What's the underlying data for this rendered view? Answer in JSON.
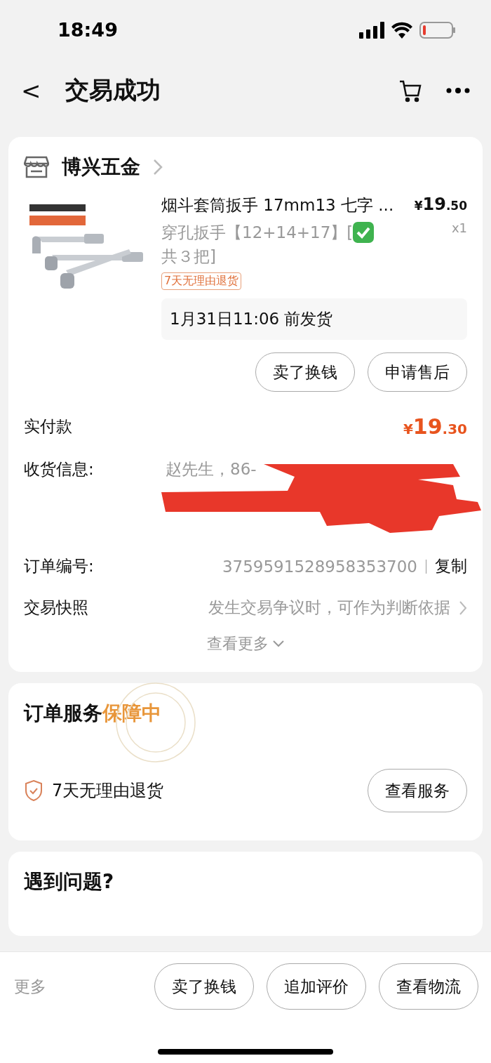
{
  "status_bar": {
    "time": "18:49"
  },
  "nav": {
    "back": "<",
    "title": "交易成功"
  },
  "order": {
    "shop": "博兴五金",
    "product": {
      "title": "烟斗套筒扳手 17mm13 七字 ...",
      "spec_before": "穿孔扳手【12+14+17】[",
      "spec_after": "共３把]",
      "price_symbol": "¥",
      "price_int": "19",
      "price_dec": ".50",
      "qty": "x1",
      "tag": "7天无理由退货",
      "ship": "1月31日11:06 前发货"
    },
    "item_actions": [
      "卖了换钱",
      "申请售后"
    ],
    "paid": {
      "label": "实付款",
      "symbol": "¥",
      "int": "19",
      "dec": ".30"
    },
    "rows": [
      {
        "kind": "address",
        "label": "收货信息:",
        "value": "赵先生，86-"
      },
      {
        "kind": "copy",
        "label": "订单编号:",
        "value": "3759591528958353700",
        "action": "复制"
      },
      {
        "kind": "link",
        "label": "交易快照",
        "value": "发生交易争议时，可作为判断依据"
      }
    ],
    "more": "查看更多"
  },
  "service": {
    "title": "订单服务",
    "title_accent": "保障中",
    "items": [
      {
        "label": "7天无理由退货",
        "action": "查看服务"
      }
    ]
  },
  "problem": {
    "title": "遇到问题?"
  },
  "bottom_bar": {
    "more": "更多",
    "buttons": [
      "卖了换钱",
      "追加评价",
      "查看物流"
    ]
  }
}
